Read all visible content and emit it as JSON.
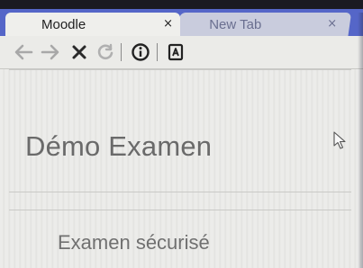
{
  "browser": {
    "tabs": [
      {
        "label": "Moodle",
        "active": true,
        "close": "×"
      },
      {
        "label": "New Tab",
        "active": false,
        "close": "×"
      }
    ],
    "toolbar": {
      "icons": [
        "back-arrow-icon",
        "forward-arrow-icon",
        "stop-icon",
        "reload-icon",
        "info-icon",
        "reader-icon"
      ]
    },
    "colors": {
      "tabstrip": "#5566c8",
      "active_tab": "#efefec",
      "inactive_tab": "#c9ccdd"
    }
  },
  "page": {
    "title": "Démo Examen",
    "section": "Examen sécurisé"
  }
}
